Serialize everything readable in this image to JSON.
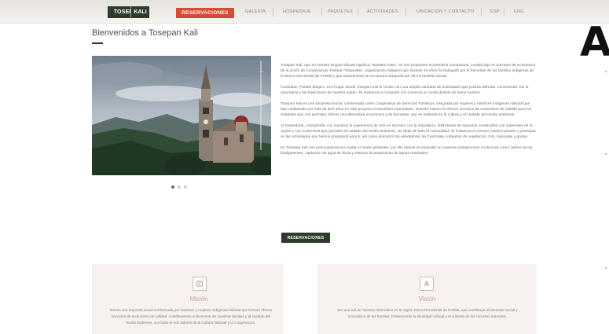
{
  "nav": {
    "logo_left": "TOSEPAN",
    "logo_right": "KALI",
    "reservations": "RESERVACIONES",
    "items": [
      "GALERÍA",
      "HOSPEDAJE",
      "PAQUETES",
      "ACTIVIDADES",
      "UBICACIÓN Y CONTACTO",
      "ESP",
      "ENG"
    ]
  },
  "side_letter": "A",
  "page": {
    "title": "Bienvenidos a Tosepan Kali"
  },
  "carousel": {
    "dots": 3,
    "active": 0
  },
  "intro": {
    "p1": "Tosepan Kali, que en nuestra lengua náhuatl significa \"Nuestra Casa\", es una propuesta ecoturística comunitaria, creada bajo el concepto de ecoturismo de la Unión de Cooperativas Tosepan Titataniske, organización indígena que durante 40 años ha trabajado por el bienestar de las familias indígenas de la Sierra Nororiental de Puebla y que actualmente se encuentra integrada por 36 mil familias socias.",
    "p2": "Cuetzalan, Pueblo Mágico, es el lugar donde Tosepan Kali te recibe con una amplia variedad de actividades que podrás disfrutar, conviviendo con la naturaleza y las tradiciones de nuestra región. Te invitamos a compartir con nosotros un modo distinto de hacer turismo.",
    "p3": "Tosepan Kali es una Empresa Social, conformada como Cooperativa de Servicios Turísticos, integrada por mujeres y hombres indígenas náhuatl que han colaborado por más de diez años en este proyecto ecoturístico comunitario. Nuestra misión es ofrecer servicios de ecoturismo de calidad para los visitantes que nos permitan ofrecer una alternativa económica y de bienestar, que se sustente en la cultura y el cuidado del medio ambiente.",
    "p4": "Al hospedarte, compartirás con nosotros la experiencia de vivir en armonía con la naturaleza, disfrutando de espacios construidos con materiales de la región y con ecotecnias que permiten el cuidado del medio ambiente, sin dejar de lado la comodidad. Te invitamos a conocer nuestro paraíso y participar en las actividades que hemos preparado para ti, así como descubrir los alrededores de Cuetzalan, rodeados de vegetación, ríos, cascadas y grutas.",
    "p5": "En Tosepan Kali nos preocupamos por cuidar el medio ambiente, por ello hemos incorporado en nuestras instalaciones ecotecnias como: baños secos, biodigestores, captación de agua de lluvia y sistema de tratamiento de aguas residuales.",
    "button": "RESERVACIONES"
  },
  "cards": [
    {
      "icon": "mission-icon",
      "title": "Misión",
      "text": "Somos una empresa social conformada por hombres y mujeres indígenas náhuatl que buscan ofrecer servicios de ecoturismo de calidad, contribuyendo al bienestar de nuestras familias y al cuidado del medio ambiente, con base en los valores de la Cultura Náhuatl y la Cooperación."
    },
    {
      "icon": "vision-icon",
      "title": "Visión",
      "text": "Ser una red de Turismo Alternativo en la región Sierra Nororiental de Puebla, que contribuya al bienestar social y económico de las familias, fortaleciendo la identidad cultural y el cuidado de los recursos naturales."
    }
  ]
}
